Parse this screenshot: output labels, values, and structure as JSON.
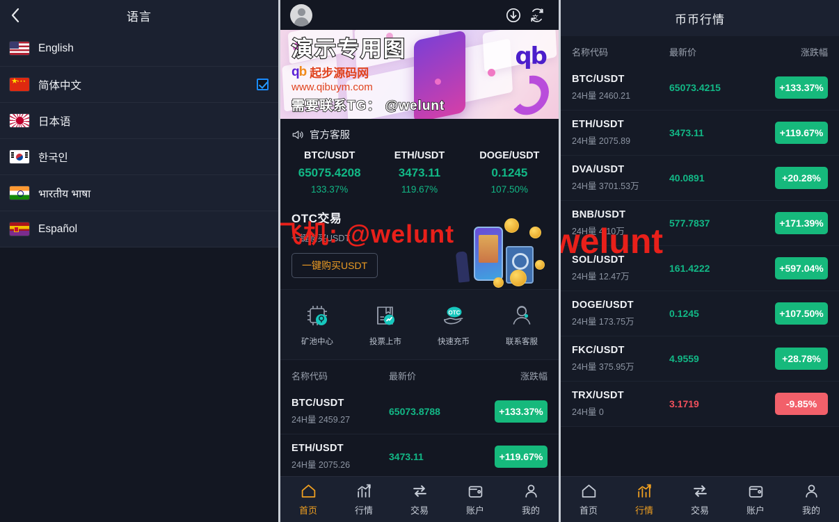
{
  "left_panel": {
    "title": "语言",
    "back_icon": "chevron-left-icon",
    "items": [
      {
        "label": "English",
        "flag": "us",
        "selected": false
      },
      {
        "label": "简体中文",
        "flag": "cn",
        "selected": true
      },
      {
        "label": "日本语",
        "flag": "jp",
        "selected": false
      },
      {
        "label": "한국인",
        "flag": "kr",
        "selected": false
      },
      {
        "label": "भारतीय भाषा",
        "flag": "in",
        "selected": false
      },
      {
        "label": "Español",
        "flag": "es",
        "selected": false
      }
    ]
  },
  "middle_panel": {
    "topbar": {
      "avatar": "user-avatar",
      "download_icon": "download-icon",
      "translate_icon": "translate-icon"
    },
    "banner": {
      "watermark_main": "演示专用图",
      "watermark_site_brand": "起步源码网",
      "watermark_url": "www.qibuym.com",
      "watermark_tg": "需要联系TG： @welunt",
      "logo_text": "qb"
    },
    "notice": {
      "icon": "megaphone-icon",
      "text": "官方客服"
    },
    "tickers": [
      {
        "symbol": "BTC/USDT",
        "price": "65075.4208",
        "change": "133.37%"
      },
      {
        "symbol": "ETH/USDT",
        "price": "3473.11",
        "change": "119.67%"
      },
      {
        "symbol": "DOGE/USDT",
        "price": "0.1245",
        "change": "107.50%"
      }
    ],
    "otc": {
      "title": "OTC交易",
      "subtitle": "一键购买USDT",
      "button": "一键购买USDT",
      "watermark": "飞机: @welunt"
    },
    "quick_entries": [
      {
        "label": "矿池中心",
        "icon": "chip-mining-icon"
      },
      {
        "label": "投票上市",
        "icon": "vote-listing-icon"
      },
      {
        "label": "快速充币",
        "icon": "otc-hand-icon"
      },
      {
        "label": "联系客服",
        "icon": "support-agent-icon"
      }
    ],
    "market": {
      "headers": {
        "name": "名称代码",
        "price": "最新价",
        "change": "涨跌幅"
      },
      "rows": [
        {
          "symbol": "BTC/USDT",
          "volume": "24H量 2459.27",
          "price": "65073.8788",
          "change": "+133.37%",
          "direction": "up"
        },
        {
          "symbol": "ETH/USDT",
          "volume": "24H量 2075.26",
          "price": "3473.11",
          "change": "+119.67%",
          "direction": "up"
        }
      ]
    },
    "tabbar": [
      {
        "label": "首页",
        "icon": "home-icon",
        "active": true
      },
      {
        "label": "行情",
        "icon": "chart-icon",
        "active": false
      },
      {
        "label": "交易",
        "icon": "swap-icon",
        "active": false
      },
      {
        "label": "账户",
        "icon": "wallet-icon",
        "active": false
      },
      {
        "label": "我的",
        "icon": "person-icon",
        "active": false
      }
    ]
  },
  "right_panel": {
    "title": "币币行情",
    "watermark": "@welunt",
    "market": {
      "headers": {
        "name": "名称代码",
        "price": "最新价",
        "change": "涨跌幅"
      },
      "rows": [
        {
          "symbol": "BTC/USDT",
          "volume": "24H量 2460.21",
          "price": "65073.4215",
          "change": "+133.37%",
          "direction": "up"
        },
        {
          "symbol": "ETH/USDT",
          "volume": "24H量 2075.89",
          "price": "3473.11",
          "change": "+119.67%",
          "direction": "up"
        },
        {
          "symbol": "DVA/USDT",
          "volume": "24H量 3701.53万",
          "price": "40.0891",
          "change": "+20.28%",
          "direction": "up"
        },
        {
          "symbol": "BNB/USDT",
          "volume": "24H量 4.10万",
          "price": "577.7837",
          "change": "+171.39%",
          "direction": "up"
        },
        {
          "symbol": "SOL/USDT",
          "volume": "24H量 12.47万",
          "price": "161.4222",
          "change": "+597.04%",
          "direction": "up"
        },
        {
          "symbol": "DOGE/USDT",
          "volume": "24H量 173.75万",
          "price": "0.1245",
          "change": "+107.50%",
          "direction": "up"
        },
        {
          "symbol": "FKC/USDT",
          "volume": "24H量 375.95万",
          "price": "4.9559",
          "change": "+28.78%",
          "direction": "up"
        },
        {
          "symbol": "TRX/USDT",
          "volume": "24H量 0",
          "price": "3.1719",
          "change": "-9.85%",
          "direction": "down"
        }
      ]
    },
    "tabbar": [
      {
        "label": "首页",
        "icon": "home-icon",
        "active": false
      },
      {
        "label": "行情",
        "icon": "chart-icon",
        "active": true
      },
      {
        "label": "交易",
        "icon": "swap-icon",
        "active": false
      },
      {
        "label": "账户",
        "icon": "wallet-icon",
        "active": false
      },
      {
        "label": "我的",
        "icon": "person-icon",
        "active": false
      }
    ]
  },
  "colors": {
    "up_green": "#16b97c",
    "down_red": "#f2606a",
    "price_green": "#12b886",
    "price_red": "#f1505c",
    "accent_orange": "#f0a020",
    "panel_bg": "#131722",
    "row_bg": "#1b2130",
    "checkbox_blue": "#1a8cff"
  }
}
